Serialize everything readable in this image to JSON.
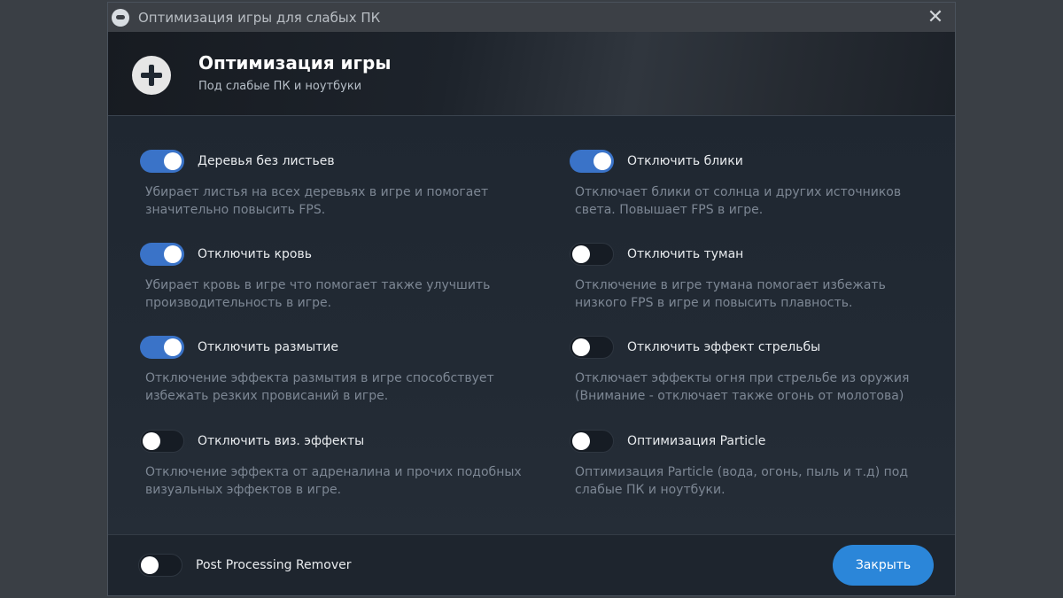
{
  "window": {
    "title": "Оптимизация игры для слабых ПК"
  },
  "header": {
    "title": "Оптимизация игры",
    "subtitle": "Под слабые ПК и ноутбуки"
  },
  "options": [
    {
      "label": "Деревья без листьев",
      "enabled": true,
      "desc1": "Убирает листья на всех деревьях в игре и помогает",
      "desc2": "значительно повысить FPS."
    },
    {
      "label": "Отключить блики",
      "enabled": true,
      "desc1": "Отключает блики от солнца и других источников",
      "desc2": "света. Повышает FPS в игре."
    },
    {
      "label": "Отключить кровь",
      "enabled": true,
      "desc1": "Убирает кровь в игре что помогает также улучшить",
      "desc2": "производительность в игре."
    },
    {
      "label": "Отключить туман",
      "enabled": false,
      "desc1": "Отключение в игре тумана помогает избежать",
      "desc2": "низкого FPS в игре и повысить плавность."
    },
    {
      "label": "Отключить размытие",
      "enabled": true,
      "desc1": "Отключение эффекта размытия в игре способствует",
      "desc2": "избежать резких провисаний в игре."
    },
    {
      "label": "Отключить эффект стрельбы",
      "enabled": false,
      "desc1": "Отключает эффекты огня при стрельбе из оружия",
      "desc2": "(Внимание - отключает также огонь от молотова)"
    },
    {
      "label": "Отключить виз. эффекты",
      "enabled": false,
      "desc1": "Отключение эффекта от адреналина и прочих подобных",
      "desc2": "визуальных эффектов в игре."
    },
    {
      "label": "Оптимизация Particle",
      "enabled": false,
      "desc1": "Оптимизация Particle (вода, огонь, пыль и т.д) под",
      "desc2": "слабые ПК и ноутбуки."
    }
  ],
  "footer": {
    "post_processing_label": "Post Processing Remover",
    "post_processing_enabled": false,
    "close_label": "Закрыть"
  },
  "colors": {
    "toggle_on": "#3a73c8",
    "close_button": "#2b86d9"
  }
}
